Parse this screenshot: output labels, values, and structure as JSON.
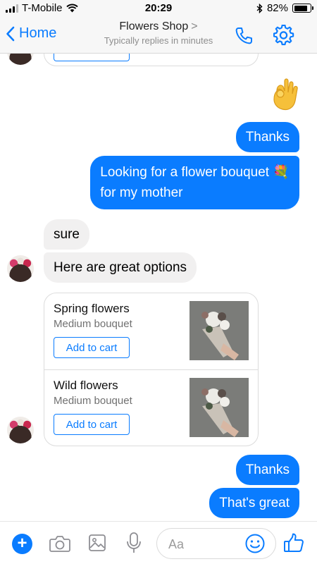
{
  "status_bar": {
    "carrier": "T-Mobile",
    "time": "20:29",
    "battery_text": "82%",
    "battery_level": 0.82
  },
  "nav": {
    "back_label": "Home",
    "title": "Flowers Shop",
    "title_chevron": ">",
    "subtitle": "Typically replies in minutes",
    "call_icon": "phone-icon",
    "settings_icon": "gear-icon"
  },
  "chat": {
    "messages": [
      {
        "from": "me",
        "type": "emoji",
        "emoji": "ok-hand-emoji"
      },
      {
        "from": "me",
        "type": "text",
        "text": "Thanks"
      },
      {
        "from": "me",
        "type": "text",
        "line1": "Looking for a flower bouquet 💐",
        "line2": "for my mother"
      },
      {
        "from": "shop",
        "type": "text",
        "text": "sure"
      },
      {
        "from": "shop",
        "type": "text",
        "text": "Here are great options"
      },
      {
        "from": "me",
        "type": "text",
        "text": "Thanks"
      },
      {
        "from": "me",
        "type": "text",
        "text": "That's great"
      }
    ],
    "products": [
      {
        "title": "Spring flowers",
        "subtitle": "Medium bouquet",
        "button": "Add to cart"
      },
      {
        "title": "Wild flowers",
        "subtitle": "Medium bouquet",
        "button": "Add to cart"
      }
    ]
  },
  "composer": {
    "placeholder": "Aa",
    "value": "",
    "icons": [
      "plus-icon",
      "camera-icon",
      "image-icon",
      "microphone-icon",
      "emoji-icon",
      "thumbs-up-icon"
    ]
  },
  "colors": {
    "accent": "#0a7cff",
    "incoming_bubble": "#f1f0f0",
    "bar_background": "#f7f7f7"
  }
}
